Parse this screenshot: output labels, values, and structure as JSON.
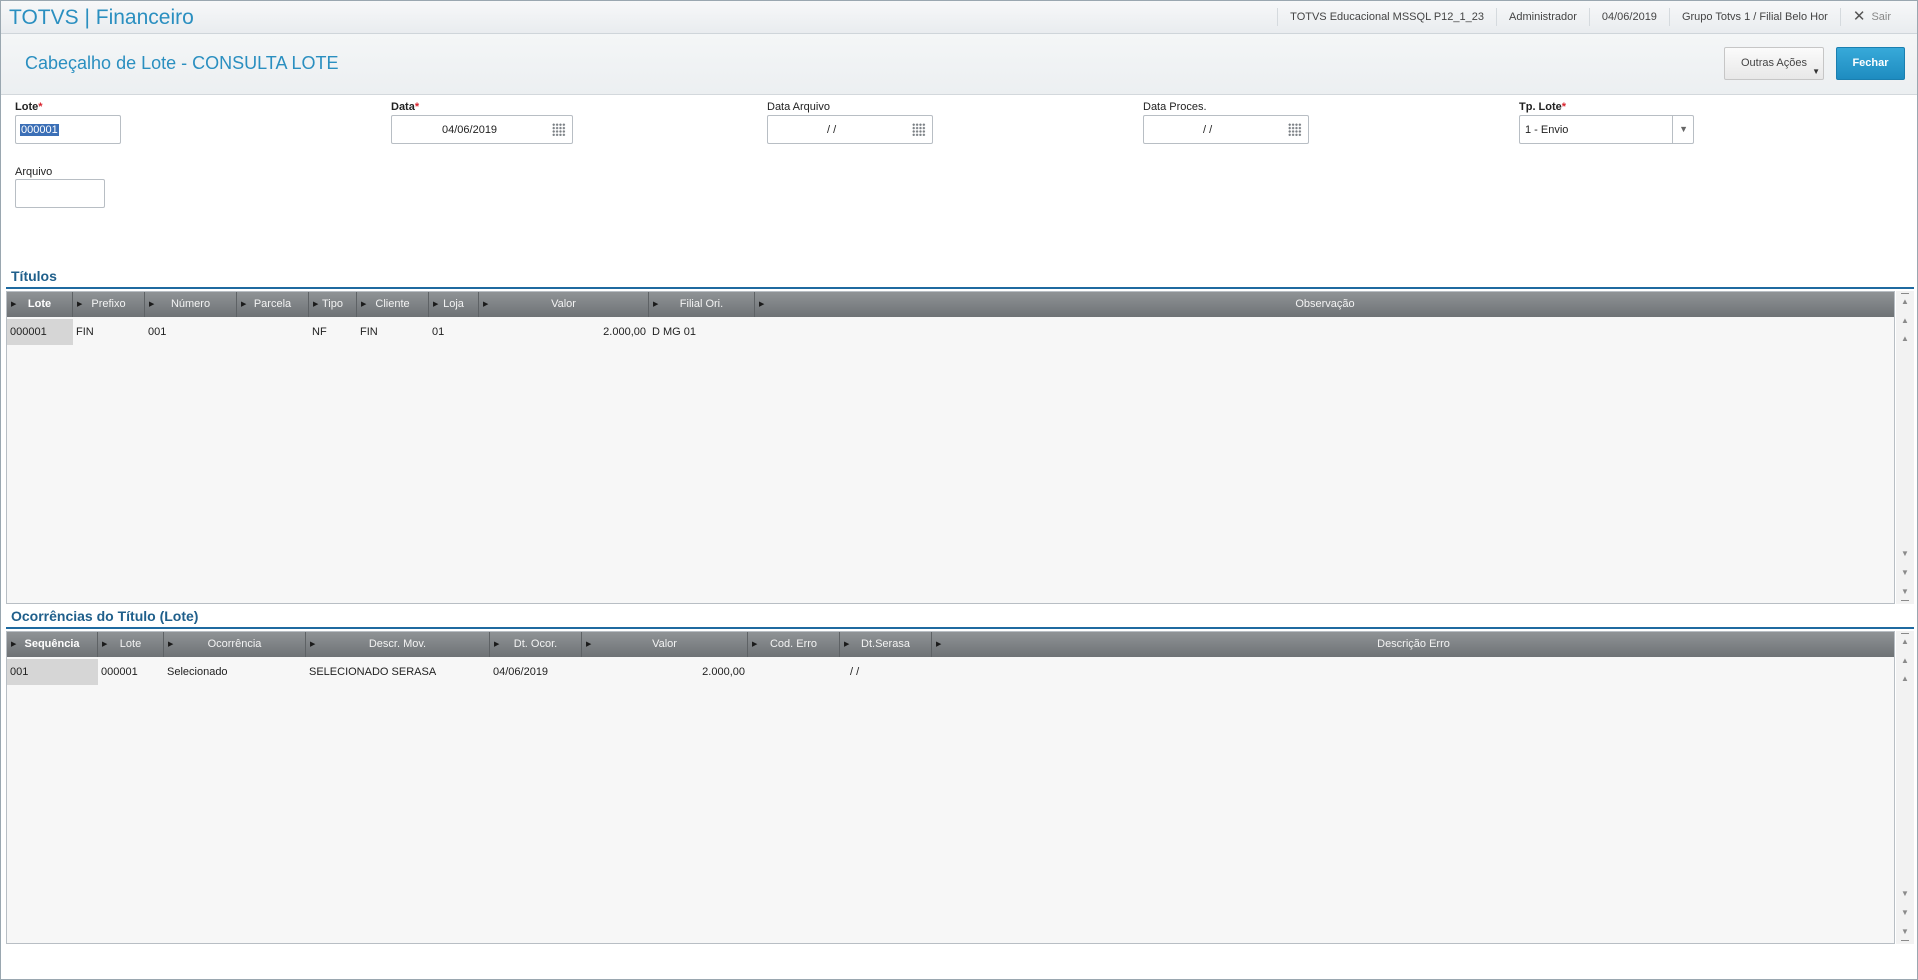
{
  "app": {
    "title": "TOTVS | Financeiro"
  },
  "topbar": {
    "environment": "TOTVS Educacional MSSQL P12_1_23",
    "user": "Administrador",
    "date": "04/06/2019",
    "branch": "Grupo Totvs 1 / Filial Belo Hor",
    "exit_label": "Sair"
  },
  "header": {
    "title": "Cabeçalho de Lote - CONSULTA LOTE",
    "other_actions_label": "Outras Ações",
    "close_label": "Fechar"
  },
  "form": {
    "lote": {
      "label": "Lote",
      "value": "000001"
    },
    "data": {
      "label": "Data",
      "value": "04/06/2019"
    },
    "data_arquivo": {
      "label": "Data Arquivo",
      "value": "/ /"
    },
    "data_proces": {
      "label": "Data Proces.",
      "value": "/ /"
    },
    "tp_lote": {
      "label": "Tp. Lote",
      "value": "1 - Envio"
    },
    "arquivo": {
      "label": "Arquivo",
      "value": ""
    },
    "required_mark": "*"
  },
  "titulos": {
    "title": "Títulos",
    "columns": [
      "Lote",
      "Prefixo",
      "Número",
      "Parcela",
      "Tipo",
      "Cliente",
      "Loja",
      "Valor",
      "Filial Ori.",
      "Observação"
    ],
    "rows": [
      [
        "000001",
        "FIN",
        "001",
        "",
        "NF",
        "FIN",
        "01",
        "2.000,00",
        "D MG 01",
        ""
      ]
    ]
  },
  "ocorrencias": {
    "title": "Ocorrências do Título (Lote)",
    "columns": [
      "Sequência",
      "Lote",
      "Ocorrência",
      "Descr. Mov.",
      "Dt. Ocor.",
      "Valor",
      "Cod. Erro",
      "Dt.Serasa",
      "Descrição Erro"
    ],
    "rows": [
      [
        "001",
        "000001",
        "Selecionado",
        "SELECIONADO SERASA",
        "04/06/2019",
        "2.000,00",
        "",
        "/ /",
        ""
      ]
    ]
  }
}
